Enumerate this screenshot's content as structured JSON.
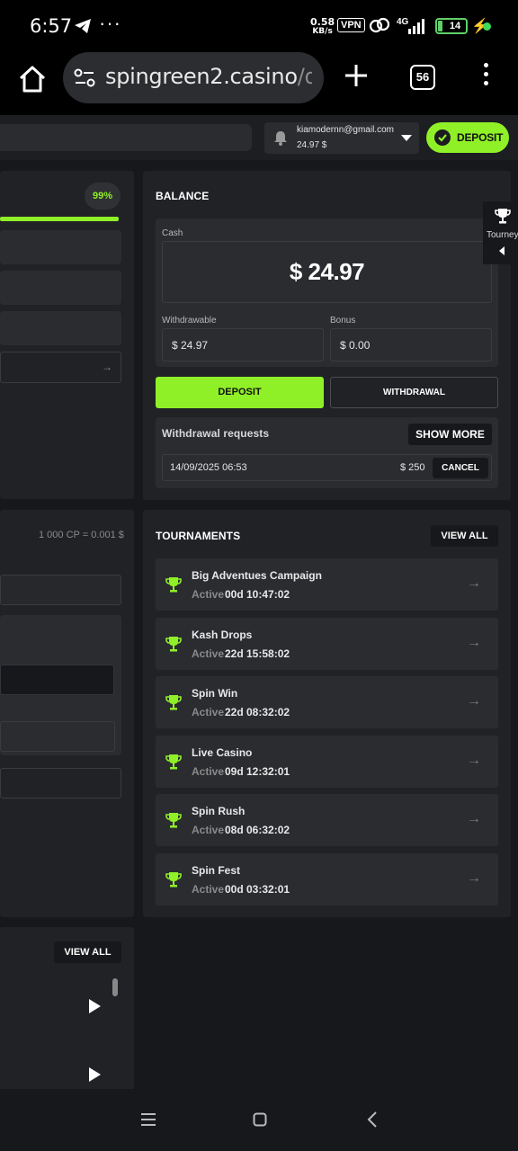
{
  "status_bar": {
    "time": "6:57",
    "speed_top": "0.58",
    "speed_bottom": "KB/s",
    "vpn": "VPN",
    "network": "4G",
    "battery": "14"
  },
  "browser": {
    "url_host": "spingreen2.casino",
    "url_path": "/das",
    "tab_count": "56"
  },
  "header": {
    "email": "kiamodernn@gmail.com",
    "balance": "24.97 $",
    "deposit_label": "DEPOSIT"
  },
  "left_column": {
    "progress_percent": "99%",
    "progress_value": 0.99,
    "cp_rate": "1 000 CP = 0.001 $",
    "view_all_label": "VIEW ALL"
  },
  "balance": {
    "title": "BALANCE",
    "cash_label": "Cash",
    "cash_value": "$ 24.97",
    "withdrawable_label": "Withdrawable",
    "withdrawable_value": "$ 24.97",
    "bonus_label": "Bonus",
    "bonus_value": "$ 0.00",
    "deposit_button": "DEPOSIT",
    "withdrawal_button": "WITHDRAWAL",
    "withdrawal_requests_label": "Withdrawal requests",
    "show_more_button": "SHOW MORE",
    "request": {
      "date": "14/09/2025 06:53",
      "amount": "$ 250",
      "cancel_button": "CANCEL"
    }
  },
  "tourney_tab": {
    "label": "Tourney"
  },
  "tournaments": {
    "title": "TOURNAMENTS",
    "view_all_label": "VIEW ALL",
    "items": [
      {
        "name": "Big Adventues Campaign",
        "status": "Active",
        "time": "00d 10:47:02"
      },
      {
        "name": "Kash Drops",
        "status": "Active",
        "time": "22d 15:58:02"
      },
      {
        "name": "Spin Win",
        "status": "Active",
        "time": "22d 08:32:02"
      },
      {
        "name": "Live Casino",
        "status": "Active",
        "time": "09d 12:32:01"
      },
      {
        "name": "Spin Rush",
        "status": "Active",
        "time": "08d 06:32:02"
      },
      {
        "name": "Spin Fest",
        "status": "Active",
        "time": "00d 03:32:01"
      }
    ]
  },
  "colors": {
    "accent": "#90f028",
    "background": "#17181b",
    "card": "#202226"
  }
}
